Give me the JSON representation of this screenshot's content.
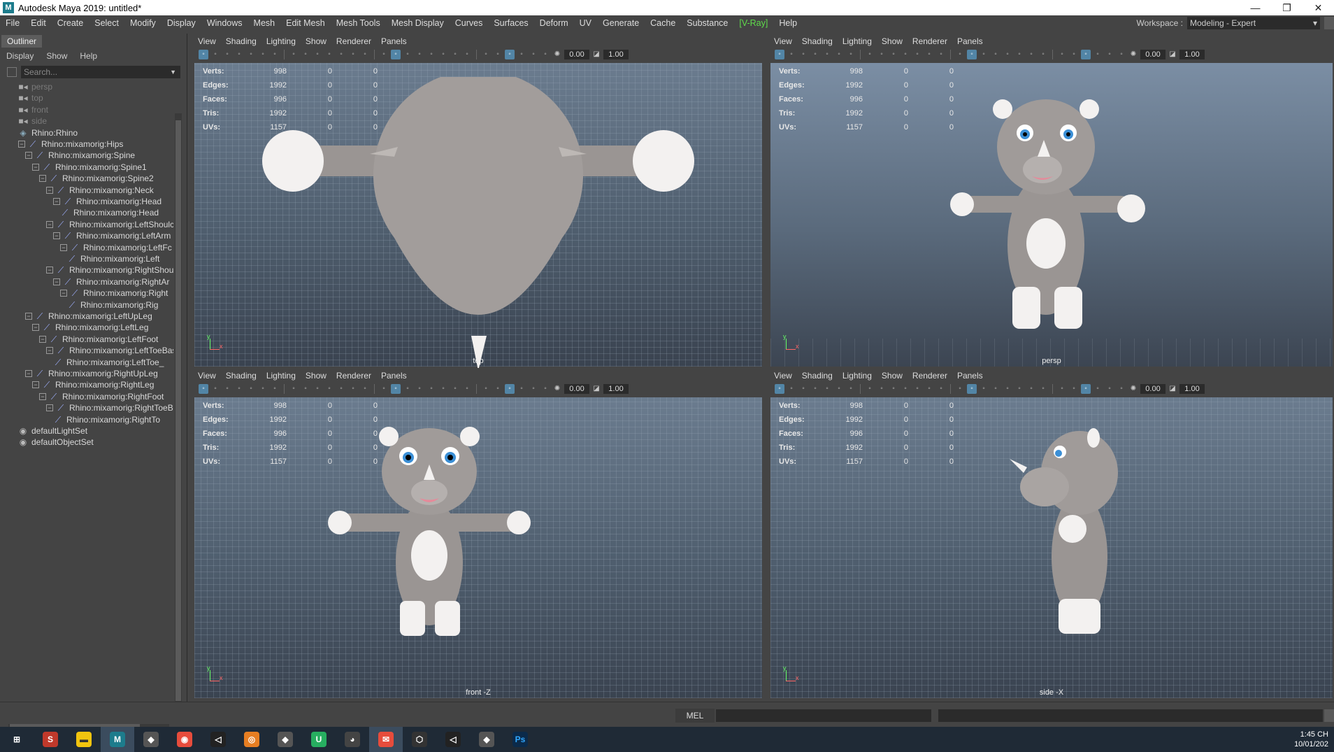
{
  "window": {
    "title": "Autodesk Maya 2019: untitled*",
    "app_icon": "M"
  },
  "menubar": {
    "items": [
      "File",
      "Edit",
      "Create",
      "Select",
      "Modify",
      "Display",
      "Windows",
      "Mesh",
      "Edit Mesh",
      "Mesh Tools",
      "Mesh Display",
      "Curves",
      "Surfaces",
      "Deform",
      "UV",
      "Generate",
      "Cache",
      "Substance",
      "[V-Ray]",
      "Help"
    ],
    "workspace_label": "Workspace :",
    "workspace_value": "Modeling - Expert"
  },
  "outliner": {
    "tab": "Outliner",
    "menu": [
      "Display",
      "Show",
      "Help"
    ],
    "search_placeholder": "Search...",
    "items": [
      {
        "label": "persp",
        "depth": 1,
        "icon": "camera-icon",
        "dim": true,
        "exp": ""
      },
      {
        "label": "top",
        "depth": 1,
        "icon": "camera-icon",
        "dim": true,
        "exp": ""
      },
      {
        "label": "front",
        "depth": 1,
        "icon": "camera-icon",
        "dim": true,
        "exp": ""
      },
      {
        "label": "side",
        "depth": 1,
        "icon": "camera-icon",
        "dim": true,
        "exp": ""
      },
      {
        "label": "Rhino:Rhino",
        "depth": 1,
        "icon": "mesh-icon",
        "dim": false,
        "exp": ""
      },
      {
        "label": "Rhino:mixamorig:Hips",
        "depth": 1,
        "icon": "joint-icon",
        "dim": false,
        "exp": "−"
      },
      {
        "label": "Rhino:mixamorig:Spine",
        "depth": 2,
        "icon": "joint-icon",
        "dim": false,
        "exp": "−"
      },
      {
        "label": "Rhino:mixamorig:Spine1",
        "depth": 3,
        "icon": "joint-icon",
        "dim": false,
        "exp": "−"
      },
      {
        "label": "Rhino:mixamorig:Spine2",
        "depth": 4,
        "icon": "joint-icon",
        "dim": false,
        "exp": "−"
      },
      {
        "label": "Rhino:mixamorig:Neck",
        "depth": 5,
        "icon": "joint-icon",
        "dim": false,
        "exp": "−"
      },
      {
        "label": "Rhino:mixamorig:Head",
        "depth": 6,
        "icon": "joint-icon",
        "dim": false,
        "exp": "−"
      },
      {
        "label": "Rhino:mixamorig:Head",
        "depth": 7,
        "icon": "joint-icon",
        "dim": false,
        "exp": ""
      },
      {
        "label": "Rhino:mixamorig:LeftShoulc",
        "depth": 5,
        "icon": "joint-icon",
        "dim": false,
        "exp": "−"
      },
      {
        "label": "Rhino:mixamorig:LeftArm",
        "depth": 6,
        "icon": "joint-icon",
        "dim": false,
        "exp": "−"
      },
      {
        "label": "Rhino:mixamorig:LeftFc",
        "depth": 7,
        "icon": "joint-icon",
        "dim": false,
        "exp": "−"
      },
      {
        "label": "Rhino:mixamorig:Left",
        "depth": 8,
        "icon": "joint-icon",
        "dim": false,
        "exp": ""
      },
      {
        "label": "Rhino:mixamorig:RightShou",
        "depth": 5,
        "icon": "joint-icon",
        "dim": false,
        "exp": "−"
      },
      {
        "label": "Rhino:mixamorig:RightAr",
        "depth": 6,
        "icon": "joint-icon",
        "dim": false,
        "exp": "−"
      },
      {
        "label": "Rhino:mixamorig:Right",
        "depth": 7,
        "icon": "joint-icon",
        "dim": false,
        "exp": "−"
      },
      {
        "label": "Rhino:mixamorig:Rig",
        "depth": 8,
        "icon": "joint-icon",
        "dim": false,
        "exp": ""
      },
      {
        "label": "Rhino:mixamorig:LeftUpLeg",
        "depth": 2,
        "icon": "joint-icon",
        "dim": false,
        "exp": "−"
      },
      {
        "label": "Rhino:mixamorig:LeftLeg",
        "depth": 3,
        "icon": "joint-icon",
        "dim": false,
        "exp": "−"
      },
      {
        "label": "Rhino:mixamorig:LeftFoot",
        "depth": 4,
        "icon": "joint-icon",
        "dim": false,
        "exp": "−"
      },
      {
        "label": "Rhino:mixamorig:LeftToeBas",
        "depth": 5,
        "icon": "joint-icon",
        "dim": false,
        "exp": "−"
      },
      {
        "label": "Rhino:mixamorig:LeftToe_",
        "depth": 6,
        "icon": "joint-icon",
        "dim": false,
        "exp": ""
      },
      {
        "label": "Rhino:mixamorig:RightUpLeg",
        "depth": 2,
        "icon": "joint-icon",
        "dim": false,
        "exp": "−"
      },
      {
        "label": "Rhino:mixamorig:RightLeg",
        "depth": 3,
        "icon": "joint-icon",
        "dim": false,
        "exp": "−"
      },
      {
        "label": "Rhino:mixamorig:RightFoot",
        "depth": 4,
        "icon": "joint-icon",
        "dim": false,
        "exp": "−"
      },
      {
        "label": "Rhino:mixamorig:RightToeB",
        "depth": 5,
        "icon": "joint-icon",
        "dim": false,
        "exp": "−"
      },
      {
        "label": "Rhino:mixamorig:RightTo",
        "depth": 6,
        "icon": "joint-icon",
        "dim": false,
        "exp": ""
      },
      {
        "label": "defaultLightSet",
        "depth": 1,
        "icon": "set-icon",
        "dim": false,
        "exp": ""
      },
      {
        "label": "defaultObjectSet",
        "depth": 1,
        "icon": "set-icon",
        "dim": false,
        "exp": ""
      }
    ]
  },
  "viewport_menu": [
    "View",
    "Shading",
    "Lighting",
    "Show",
    "Renderer",
    "Panels"
  ],
  "viewports": [
    {
      "id": "top",
      "label": "top",
      "field1": "0.00",
      "field2": "1.00"
    },
    {
      "id": "persp",
      "label": "persp",
      "field1": "0.00",
      "field2": "1.00"
    },
    {
      "id": "front",
      "label": "front -Z",
      "field1": "0.00",
      "field2": "1.00"
    },
    {
      "id": "side",
      "label": "side -X",
      "field1": "0.00",
      "field2": "1.00"
    }
  ],
  "hud": [
    {
      "k": "Verts:",
      "a": "998",
      "b": "0",
      "c": "0"
    },
    {
      "k": "Edges:",
      "a": "1992",
      "b": "0",
      "c": "0"
    },
    {
      "k": "Faces:",
      "a": "996",
      "b": "0",
      "c": "0"
    },
    {
      "k": "Tris:",
      "a": "1992",
      "b": "0",
      "c": "0"
    },
    {
      "k": "UVs:",
      "a": "1157",
      "b": "0",
      "c": "0"
    }
  ],
  "commandline": {
    "mel_label": "MEL"
  },
  "taskbar": {
    "clock_time": "1:45 CH",
    "clock_date": "10/01/202",
    "apps": [
      "windows-start-icon",
      "app-s-icon",
      "file-explorer-icon",
      "maya-icon",
      "app-icon",
      "chrome-icon",
      "unity-icon",
      "blender-icon",
      "app-icon",
      "upwork-icon",
      "github-icon",
      "messaging-icon",
      "unity-hub-icon",
      "unity-icon",
      "app-icon",
      "photoshop-icon"
    ]
  },
  "colors": {
    "accent": "#5285a6",
    "vray": "#5fdc4b"
  }
}
